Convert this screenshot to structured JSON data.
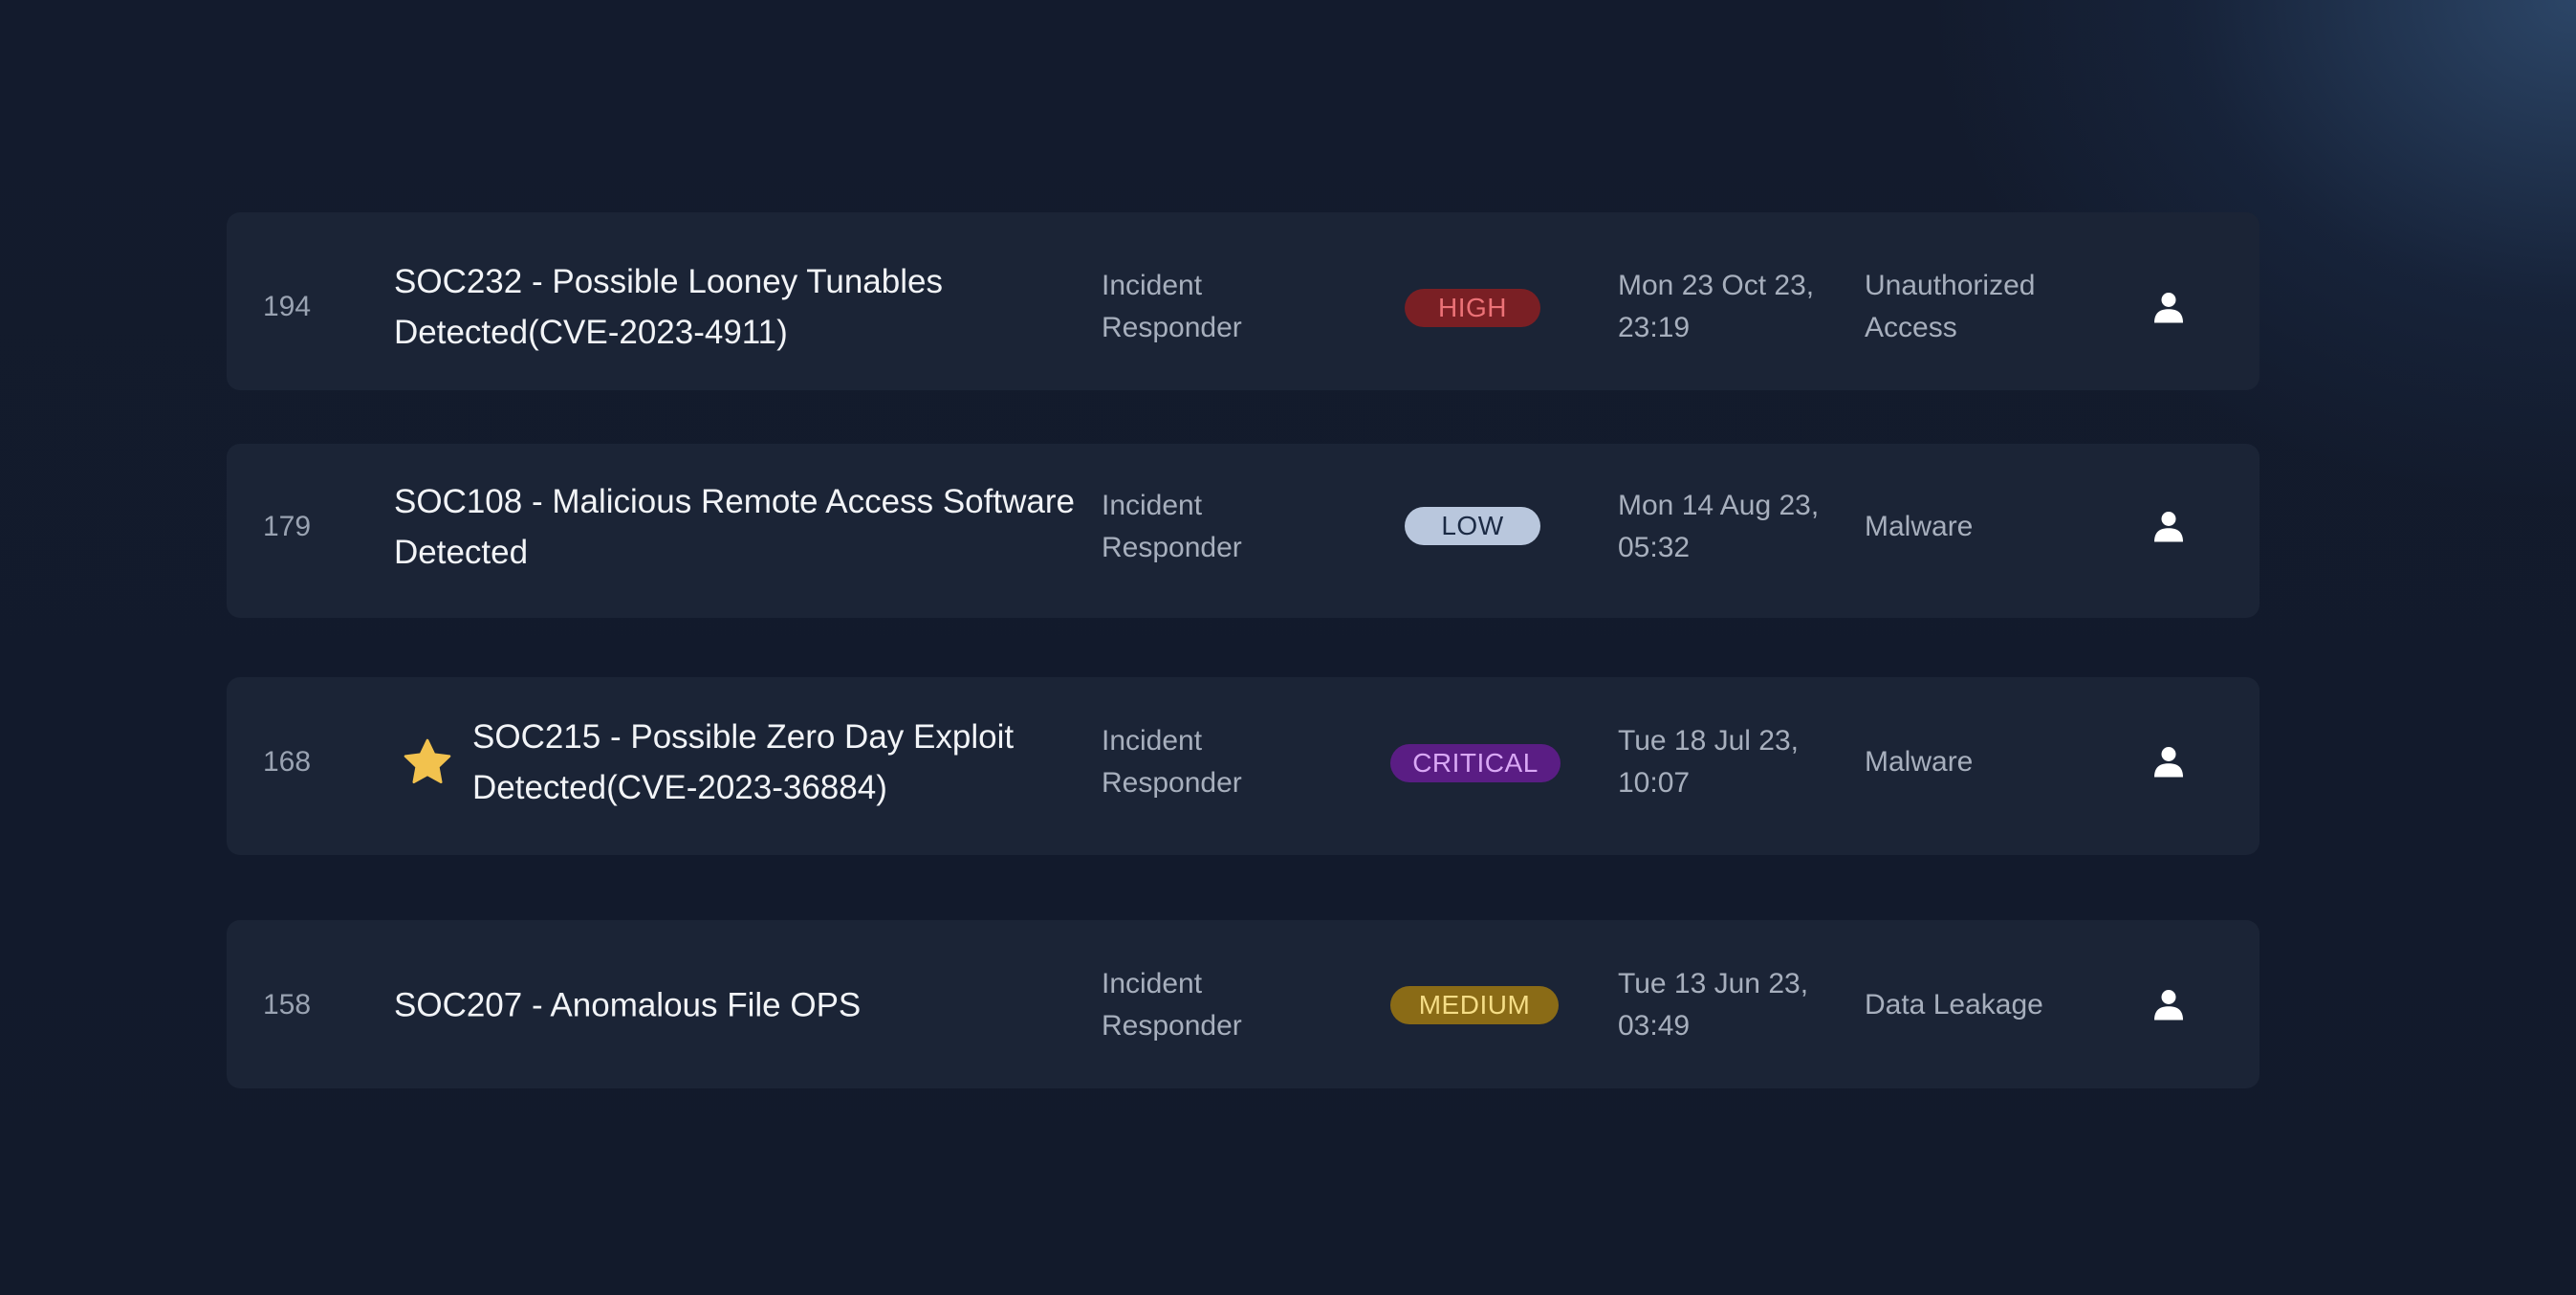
{
  "alerts": [
    {
      "id": "194",
      "title": "SOC232 - Possible Looney Tunables Detected(CVE-2023-4911)",
      "role": "Incident Responder",
      "severity": "HIGH",
      "date": "Mon 23 Oct 23, 23:19",
      "category": "Unauthorized Access",
      "starred": false,
      "assignee_icon": "user-icon"
    },
    {
      "id": "179",
      "title": "SOC108 - Malicious Remote Access Software Detected",
      "role": "Incident Responder",
      "severity": "LOW",
      "date": "Mon 14 Aug 23, 05:32",
      "category": "Malware",
      "starred": false,
      "assignee_icon": "user-icon"
    },
    {
      "id": "168",
      "title": "SOC215 - Possible Zero Day Exploit Detected(CVE-2023-36884)",
      "role": "Incident Responder",
      "severity": "CRITICAL",
      "date": "Tue 18 Jul 23, 10:07",
      "category": "Malware",
      "starred": true,
      "star_icon": "star-icon",
      "assignee_icon": "user-icon"
    },
    {
      "id": "158",
      "title": "SOC207 - Anomalous File OPS",
      "role": "Incident Responder",
      "severity": "MEDIUM",
      "date": "Tue 13 Jun 23, 03:49",
      "category": "Data Leakage",
      "starred": false,
      "assignee_icon": "user-icon"
    }
  ],
  "colors": {
    "background": "#121a2b",
    "row": "#1b2436",
    "high": "#7a1f24",
    "low": "#b9c7dd",
    "critical": "#5a1d84",
    "medium": "#8a6b16",
    "star": "#f2c24e"
  }
}
